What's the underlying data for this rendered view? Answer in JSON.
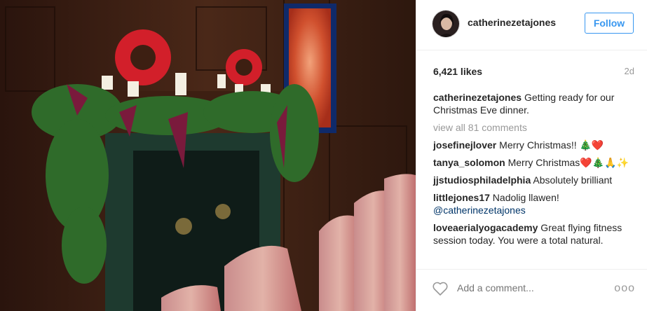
{
  "post": {
    "username": "catherinezetajones",
    "follow_label": "Follow",
    "likes": "6,421 likes",
    "time": "2d",
    "caption_user": "catherinezetajones",
    "caption_text": " Getting ready for our Christmas Eve dinner.",
    "view_all": "view all 81 comments",
    "comments": [
      {
        "user": "josefinejlover",
        "text": " Merry Christmas!! 🎄❤️"
      },
      {
        "user": "tanya_solomon",
        "text": " Merry Christmas❤️🎄🙏✨"
      },
      {
        "user": "jjstudiosphiladelphia",
        "text": " Absolutely brilliant"
      },
      {
        "user": "littlejones17",
        "text": " Nadolig llawen!",
        "mention": "@catherinezetajones"
      },
      {
        "user": "loveaerialyogacademy",
        "text": " Great flying fitness session today. You were a total natural."
      }
    ],
    "add_comment_placeholder": "Add a comment...",
    "more_label": "ooo"
  },
  "icons": {
    "heart": "heart-icon",
    "more": "more-options-icon",
    "avatar": "profile-avatar"
  },
  "colors": {
    "accent": "#3897f0",
    "muted": "#999999",
    "mention": "#003569"
  }
}
